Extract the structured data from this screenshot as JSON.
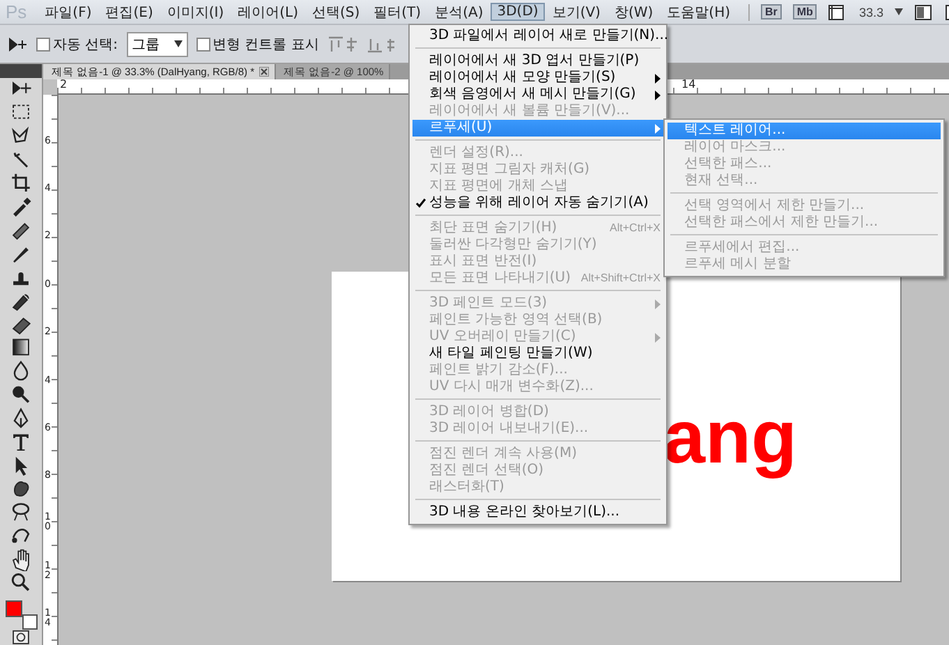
{
  "app": {
    "logo": "Ps"
  },
  "menubar": [
    {
      "label": "파일(F)",
      "selected": false
    },
    {
      "label": "편집(E)",
      "selected": false
    },
    {
      "label": "이미지(I)",
      "selected": false
    },
    {
      "label": "레이어(L)",
      "selected": false
    },
    {
      "label": "선택(S)",
      "selected": false
    },
    {
      "label": "필터(T)",
      "selected": false
    },
    {
      "label": "분석(A)",
      "selected": false
    },
    {
      "label": "3D(D)",
      "selected": true
    },
    {
      "label": "보기(V)",
      "selected": false
    },
    {
      "label": "창(W)",
      "selected": false
    },
    {
      "label": "도움말(H)",
      "selected": false
    }
  ],
  "app_bar": {
    "bridge_button": "Br",
    "mini_bridge_button": "Mb",
    "zoom": "33.3"
  },
  "options_bar": {
    "auto_select": {
      "label": "자동 선택:",
      "checked": false
    },
    "auto_select_target": "그룹",
    "transform_controls": {
      "label": "변형 컨트롤 표시",
      "checked": false
    }
  },
  "tabs": [
    {
      "label": "제목 없음-1 @ 33.3% (DalHyang, RGB/8) *",
      "selected": true
    },
    {
      "label": "제목 없음-2 @ 100%",
      "selected": false
    }
  ],
  "toolbox": {
    "swatches": [
      {
        "kind": "foreground",
        "color": "#ff0000"
      },
      {
        "kind": "background",
        "color": "#ffffff"
      }
    ]
  },
  "rulers": {
    "horizontal": [
      "2",
      "14"
    ],
    "vertical": [
      "6",
      "4",
      "2",
      "0",
      "2",
      "4",
      "6",
      "8",
      "1\n0",
      "1\n2",
      "1\n4"
    ]
  },
  "document": {
    "visible_text": "ang"
  },
  "menu": {
    "sections": [
      [
        {
          "label": "3D 파일에서 레이어 새로 만들기(N)...",
          "disabled": false
        }
      ],
      [
        {
          "label": "레이어에서 새 3D 엽서 만들기(P)",
          "disabled": false
        },
        {
          "label": "레이어에서 새 모양 만들기(S)",
          "disabled": false,
          "submenu": true
        },
        {
          "label": "회색 음영에서 새 메시 만들기(G)",
          "disabled": false,
          "submenu": true
        },
        {
          "label": "레이어에서 새 볼륨 만들기(V)...",
          "disabled": true
        },
        {
          "label": "르푸세(U)",
          "disabled": false,
          "submenu": true,
          "selected": true
        }
      ],
      [
        {
          "label": "렌더 설정(R)...",
          "disabled": true
        },
        {
          "label": "지표 평면 그림자 캐처(G)",
          "disabled": true
        },
        {
          "label": "지표 평면에 개체 스냅",
          "disabled": true
        },
        {
          "label": "성능을 위해 레이어 자동 숨기기(A)",
          "disabled": false,
          "checked": true
        }
      ],
      [
        {
          "label": "최단 표면 숨기기(H)",
          "disabled": true,
          "shortcut": "Alt+Ctrl+X"
        },
        {
          "label": "둘러싼 다각형만 숨기기(Y)",
          "disabled": true
        },
        {
          "label": "표시 표면 반전(I)",
          "disabled": true
        },
        {
          "label": "모든 표면 나타내기(U)",
          "disabled": true,
          "shortcut": "Alt+Shift+Ctrl+X"
        }
      ],
      [
        {
          "label": "3D 페인트 모드(3)",
          "disabled": true,
          "submenu": true
        },
        {
          "label": "페인트 가능한 영역 선택(B)",
          "disabled": true
        },
        {
          "label": "UV 오버레이 만들기(C)",
          "disabled": true,
          "submenu": true
        },
        {
          "label": "새 타일 페인팅 만들기(W)",
          "disabled": false
        },
        {
          "label": "페인트 밝기 감소(F)...",
          "disabled": true
        },
        {
          "label": "UV 다시 매개 변수화(Z)...",
          "disabled": true
        }
      ],
      [
        {
          "label": "3D 레이어 병합(D)",
          "disabled": true
        },
        {
          "label": "3D 레이어 내보내기(E)...",
          "disabled": true
        }
      ],
      [
        {
          "label": "점진 렌더 계속 사용(M)",
          "disabled": true
        },
        {
          "label": "점진 렌더 선택(O)",
          "disabled": true
        },
        {
          "label": "래스터화(T)",
          "disabled": true
        }
      ],
      [
        {
          "label": "3D 내용 온라인 찾아보기(L)...",
          "disabled": false
        }
      ]
    ]
  },
  "submenu": {
    "sections": [
      [
        {
          "label": "텍스트 레이어...",
          "disabled": false,
          "selected": true
        },
        {
          "label": "레이어 마스크...",
          "disabled": true
        },
        {
          "label": "선택한 패스...",
          "disabled": true
        },
        {
          "label": "현재 선택...",
          "disabled": true
        }
      ],
      [
        {
          "label": "선택 영역에서 제한 만들기...",
          "disabled": true
        },
        {
          "label": "선택한 패스에서 제한 만들기...",
          "disabled": true
        }
      ],
      [
        {
          "label": "르푸세에서 편집...",
          "disabled": true
        },
        {
          "label": "르푸세 메시 분할",
          "disabled": true
        }
      ]
    ]
  }
}
